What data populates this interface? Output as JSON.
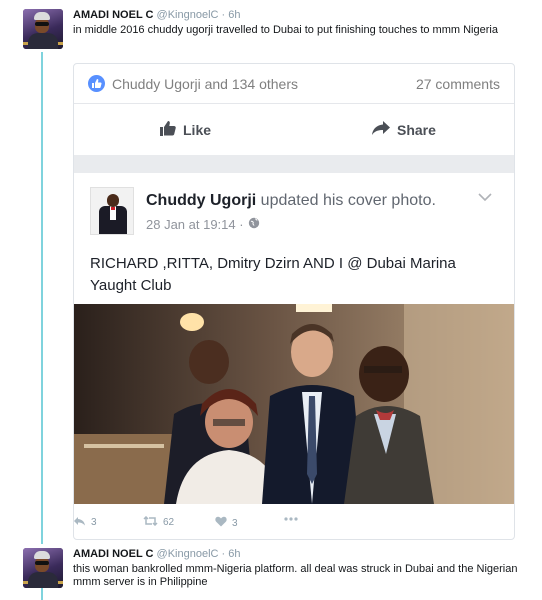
{
  "tweets": [
    {
      "name": "AMADI NOEL C",
      "handle": "@KingnoelC",
      "time": "· 6h",
      "text": "in middle 2016 chuddy ugorji travelled to Dubai to put finishing touches to mmm Nigeria"
    },
    {
      "name": "AMADI NOEL C",
      "handle": "@KingnoelC",
      "time": "· 6h",
      "text": "this woman bankrolled mmm-Nigeria platform. all deal was struck in Dubai  and the Nigerian mmm server is in Philippine"
    }
  ],
  "fb_card": {
    "likes_text": "Chuddy Ugorji and 134 others",
    "comments_text": "27 comments",
    "like_label": "Like",
    "share_label": "Share",
    "post": {
      "author": "Chuddy Ugorji",
      "action": "updated his cover photo.",
      "date": "28 Jan at 19:14 ·",
      "caption": "RICHARD ,RITTA, Dmitry Dzirn AND I @ Dubai Marina Yaught Club"
    }
  },
  "tweet_stats": {
    "replies": "3",
    "retweets": "62",
    "likes": "3"
  },
  "colors": {
    "thread": "#7fd3dd",
    "fb_blue": "#5890ff",
    "meta_gray": "#8899a6"
  }
}
